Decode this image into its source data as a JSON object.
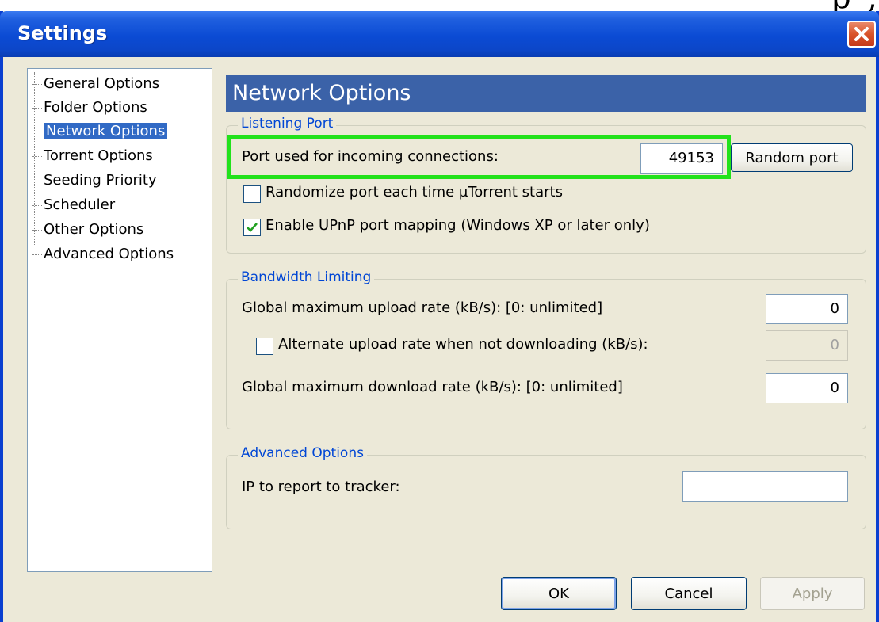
{
  "window": {
    "title": "Settings"
  },
  "nav": {
    "items": [
      {
        "label": "General Options"
      },
      {
        "label": "Folder Options"
      },
      {
        "label": "Network Options"
      },
      {
        "label": "Torrent Options"
      },
      {
        "label": "Seeding Priority"
      },
      {
        "label": "Scheduler"
      },
      {
        "label": "Other Options"
      },
      {
        "label": "Advanced Options"
      }
    ],
    "selected": "Network Options"
  },
  "main": {
    "heading": "Network Options",
    "listening_port": {
      "legend": "Listening Port",
      "port_label": "Port used for incoming connections:",
      "port_value": "49153",
      "random_button": "Random port",
      "randomize_label": "Randomize port each time µTorrent starts",
      "randomize_checked": false,
      "upnp_label": "Enable UPnP port mapping (Windows XP or later only)",
      "upnp_checked": true
    },
    "bandwidth": {
      "legend": "Bandwidth Limiting",
      "upload_label": "Global maximum upload rate (kB/s): [0: unlimited]",
      "upload_value": "0",
      "alt_label": "Alternate upload rate when not downloading (kB/s):",
      "alt_checked": false,
      "alt_value": "0",
      "download_label": "Global maximum download rate (kB/s): [0: unlimited]",
      "download_value": "0"
    },
    "advanced": {
      "legend": "Advanced Options",
      "ip_label": "IP to report to tracker:",
      "ip_value": ""
    }
  },
  "footer": {
    "ok": "OK",
    "cancel": "Cancel",
    "apply": "Apply"
  },
  "colors": {
    "titlebar": "#0b4bd4",
    "heading": "#3b62a8",
    "legend": "#0046d5",
    "highlight": "#22e21b",
    "selection": "#316ac5"
  }
}
